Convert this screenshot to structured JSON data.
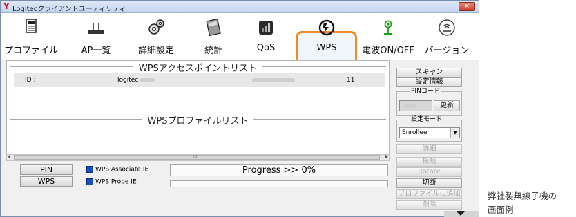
{
  "window": {
    "title": "Logitecクライアントユーティリティ",
    "close_label": "✕"
  },
  "toolbar": {
    "items": [
      {
        "label": "プロファイル",
        "icon": "profile-document-icon"
      },
      {
        "label": "AP一覧",
        "icon": "access-point-icon"
      },
      {
        "label": "詳細設定",
        "icon": "gear-settings-icon"
      },
      {
        "label": "統計",
        "icon": "calculator-icon"
      },
      {
        "label": "QoS",
        "icon": "qos-icon"
      },
      {
        "label": "WPS",
        "icon": "wps-icon"
      },
      {
        "label": "電波ON/OFF",
        "icon": "radio-antenna-icon"
      },
      {
        "label": "バージョン",
        "icon": "logitec-version-icon"
      }
    ],
    "selected": "WPS",
    "highlight_color": "#f08a24"
  },
  "ap_list": {
    "header": "WPSアクセスポイントリスト",
    "row": {
      "id_label": "ID :",
      "ssid": "logitec",
      "channel": "11"
    }
  },
  "profile_list": {
    "header": "WPSプロファイルリスト"
  },
  "bottom": {
    "pin_label": "PIN",
    "wps_label": "WPS",
    "associate_ie": "WPS Associate IE",
    "probe_ie": "WPS Probe IE",
    "progress_text": "Progress >> 0%",
    "progress_value": 0
  },
  "right_panel": {
    "scan": "スキャン",
    "info": "設定情報",
    "pin_code_caption": "PINコード",
    "update": "更新",
    "mode_caption": "設定モード",
    "mode_value": "Enrollee",
    "detail": "詳細",
    "connect": "接続",
    "rotate": "Rotate",
    "disconnect": "切断",
    "add_profile": "プロファイルに追加",
    "delete": "削除"
  },
  "scrollbar": {
    "left_arrow": "◂",
    "right_arrow": "▸",
    "grip": "III"
  },
  "caption": {
    "line1": "弊社製無線子機の",
    "line2": "画面例"
  }
}
